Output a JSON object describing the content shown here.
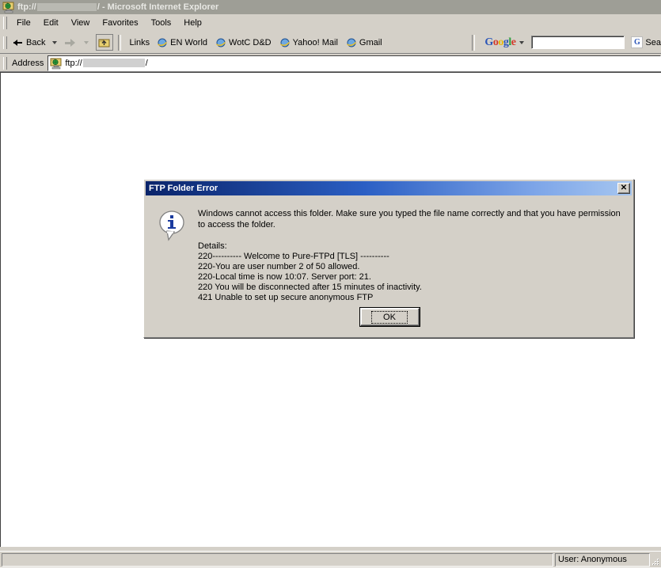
{
  "window": {
    "title_prefix": "ftp://",
    "title_suffix": "/ - Microsoft Internet Explorer",
    "icon": "ftp-folder-icon"
  },
  "menubar": {
    "items": [
      {
        "label": "File"
      },
      {
        "label": "Edit"
      },
      {
        "label": "View"
      },
      {
        "label": "Favorites"
      },
      {
        "label": "Tools"
      },
      {
        "label": "Help"
      }
    ]
  },
  "toolbar": {
    "back_label": "Back",
    "forward_label": "",
    "up_label": "Up",
    "links_label": "Links",
    "links": [
      {
        "label": "EN World"
      },
      {
        "label": "WotC D&D"
      },
      {
        "label": "Yahoo! Mail"
      },
      {
        "label": "Gmail"
      }
    ],
    "google": {
      "logo_letters": [
        "G",
        "o",
        "o",
        "g",
        "l",
        "e"
      ],
      "search_value": "",
      "search_placeholder": "",
      "search_button_label": "Sea",
      "search_button_icon": "G"
    }
  },
  "address": {
    "label": "Address",
    "scheme": "ftp://",
    "trailing": "/",
    "icon": "ftp-folder-icon"
  },
  "statusbar": {
    "left_text": "",
    "right_text": "User: Anonymous"
  },
  "dialog": {
    "title": "FTP Folder Error",
    "close_label": "✕",
    "icon": "info-icon",
    "message": "Windows cannot access this folder. Make sure you typed the file name correctly and that you have permission to access the folder.",
    "details_lines": [
      "Details:",
      "220---------- Welcome to Pure-FTPd [TLS] ----------",
      "220-You are user number 2 of 50 allowed.",
      "220-Local time is now 10:07. Server port: 21.",
      "220 You will be disconnected after 15 minutes of inactivity.",
      "421 Unable to set up secure anonymous FTP"
    ],
    "ok_label": "OK"
  },
  "colors": {
    "dialog_title_start": "#0a246a",
    "dialog_title_end": "#a6c6f0",
    "window_chrome": "#d4d0c8",
    "inactive_title": "#9e9e96",
    "content_bg": "#ffffff"
  }
}
